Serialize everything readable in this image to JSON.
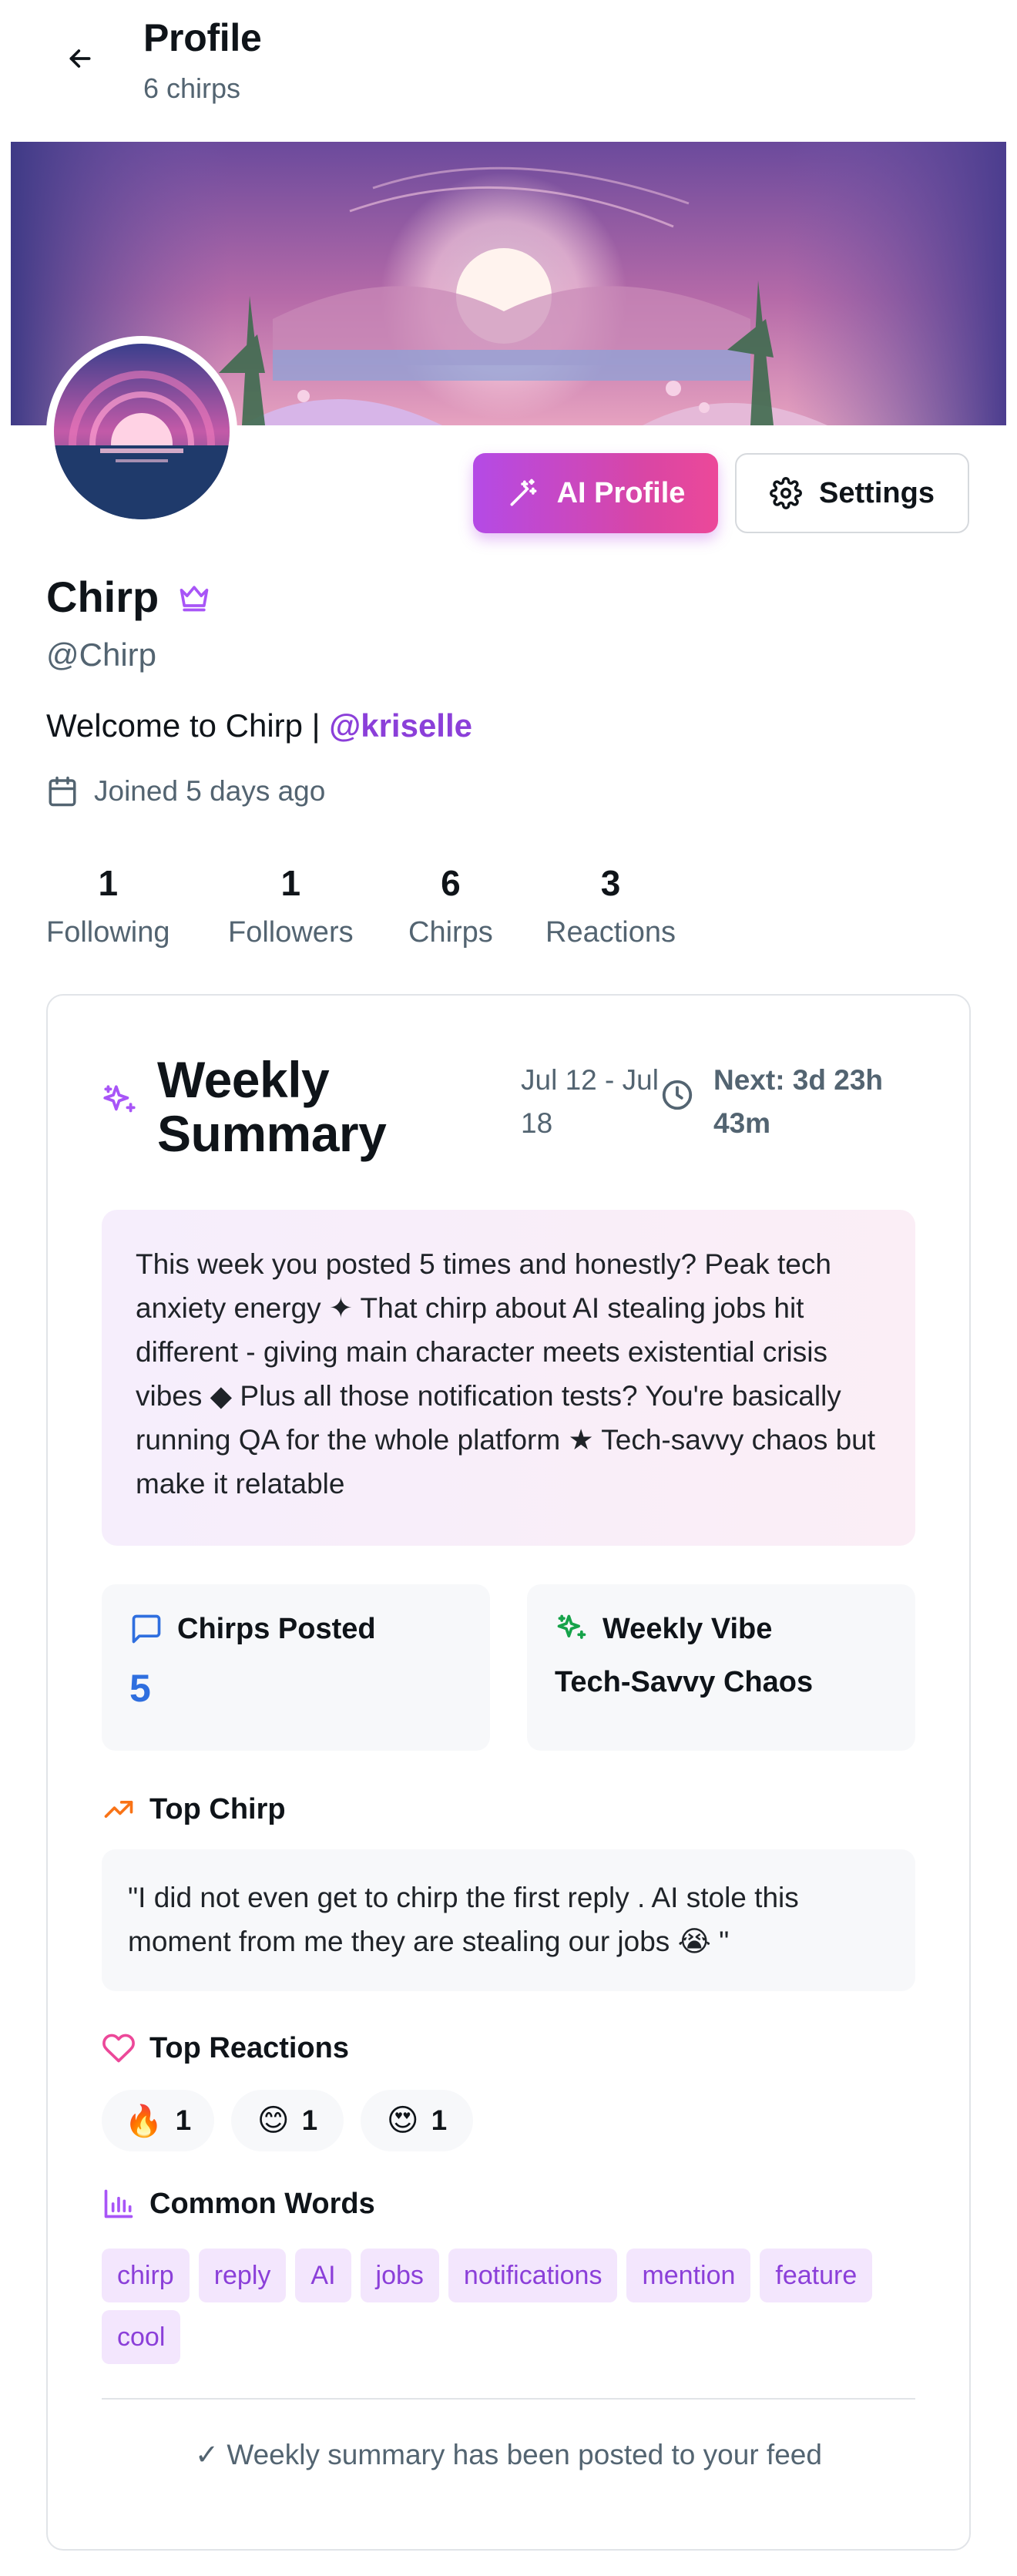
{
  "header": {
    "title": "Profile",
    "subtitle": "6 chirps"
  },
  "actions": {
    "ai_profile": "AI Profile",
    "settings": "Settings"
  },
  "profile": {
    "name": "Chirp",
    "handle": "@Chirp",
    "bio_text": "Welcome to Chirp | ",
    "bio_mention": "@kriselle",
    "joined": "Joined 5 days ago"
  },
  "stats": [
    {
      "value": "1",
      "label": "Following"
    },
    {
      "value": "1",
      "label": "Followers"
    },
    {
      "value": "6",
      "label": "Chirps"
    },
    {
      "value": "3",
      "label": "Reactions"
    }
  ],
  "weekly": {
    "title_line1": "Weekly",
    "title_line2": "Summary",
    "date_range": "Jul 12 - Jul 18",
    "next": "Next: 3d 23h 43m",
    "summary": "This week you posted 5 times and honestly? Peak tech anxiety energy ✦ That chirp about AI stealing jobs hit different - giving main character meets existential crisis vibes ◆ Plus all those notification tests? You're basically running QA for the whole platform ★ Tech-savvy chaos but make it relatable",
    "chirps_posted_label": "Chirps Posted",
    "chirps_posted_value": "5",
    "vibe_label": "Weekly Vibe",
    "vibe_value": "Tech-Savvy Chaos",
    "top_chirp_label": "Top Chirp",
    "top_chirp": "\"I did not even get to chirp the first reply . AI stole this moment from me they are stealing our jobs 😭 \"",
    "top_reactions_label": "Top Reactions",
    "reactions": [
      {
        "emoji": "🔥",
        "count": "1"
      },
      {
        "emoji": "😊",
        "count": "1"
      },
      {
        "emoji": "😍",
        "count": "1"
      }
    ],
    "common_words_label": "Common Words",
    "words": [
      "chirp",
      "reply",
      "AI",
      "jobs",
      "notifications",
      "mention",
      "feature",
      "cool"
    ],
    "footer": "✓ Weekly summary has been posted to your feed"
  },
  "colors": {
    "accent_purple": "#8b3fd9",
    "accent_pink": "#ec4899",
    "stat_blue": "#2f6fdf"
  }
}
